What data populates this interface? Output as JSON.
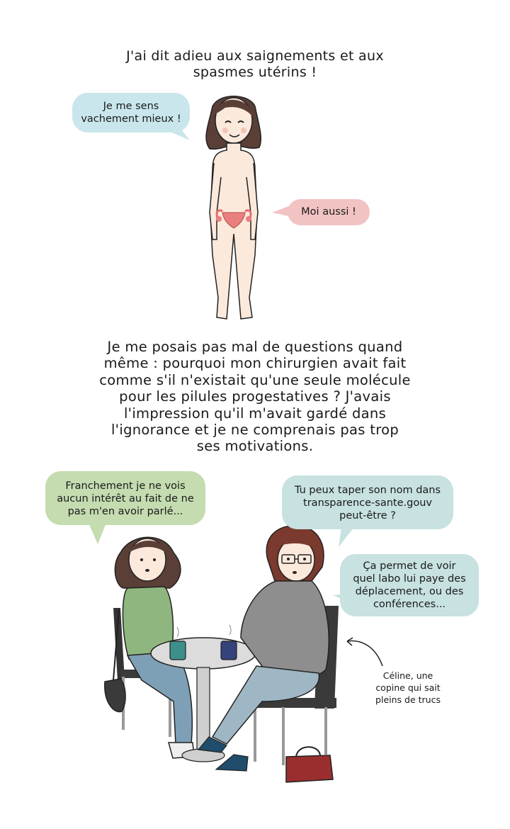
{
  "panel1": {
    "caption": "J'ai dit adieu aux saignements et aux\nspasmes utérins !",
    "bubble_left": "Je me sens\nvachement mieux !",
    "bubble_right": "Moi aussi !"
  },
  "panel2": {
    "caption": "Je me posais pas mal de questions quand\nmême : pourquoi mon chirurgien avait fait\ncomme s'il n'existait qu'une seule molécule\npour les pilules progestatives ? J'avais\nl'impression qu'il m'avait gardé dans\nl'ignorance et je ne comprenais pas trop\nses motivations."
  },
  "panel3": {
    "bubble_green": "Franchement je ne vois\naucun intérêt au fait de ne\npas m'en avoir parlé...",
    "bubble_blue_1": "Tu peux taper son nom dans\ntransparence-sante.gouv\npeut-être ?",
    "bubble_blue_2": "Ça permet de voir\nquel labo lui paye des\ndéplacement, ou des\nconférences...",
    "note": "Céline, une\ncopine qui sait\npleins de trucs"
  },
  "colors": {
    "bubble_blue": "#c9e6ec",
    "bubble_pink": "#f2c3c3",
    "bubble_green": "#c4dcb0",
    "bubble_teal": "#c8e1e1",
    "skin": "#fbe9dc",
    "hair": "#5a3f37",
    "sweater_green": "#8fb67f",
    "sweater_gray": "#8e8e8e",
    "jeans": "#7ea0b6"
  }
}
